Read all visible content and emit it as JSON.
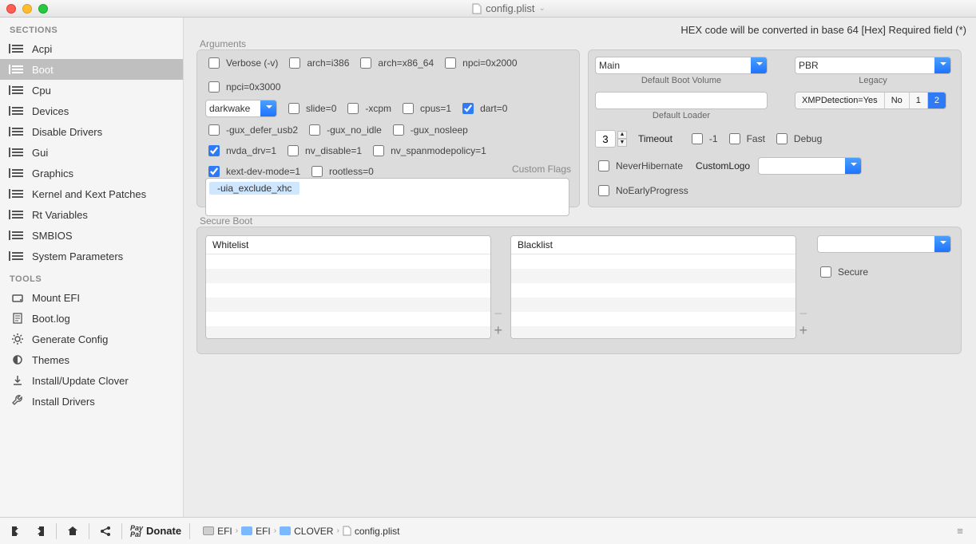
{
  "window": {
    "title": "config.plist"
  },
  "top_note": "HEX code will be converted in base 64 [Hex]    Required field (*)",
  "sidebar": {
    "header_sections": "SECTIONS",
    "header_tools": "TOOLS",
    "sections": [
      {
        "label": "Acpi",
        "selected": false
      },
      {
        "label": "Boot",
        "selected": true
      },
      {
        "label": "Cpu",
        "selected": false
      },
      {
        "label": "Devices",
        "selected": false
      },
      {
        "label": "Disable Drivers",
        "selected": false
      },
      {
        "label": "Gui",
        "selected": false
      },
      {
        "label": "Graphics",
        "selected": false
      },
      {
        "label": "Kernel and Kext Patches",
        "selected": false
      },
      {
        "label": "Rt Variables",
        "selected": false
      },
      {
        "label": "SMBIOS",
        "selected": false
      },
      {
        "label": "System Parameters",
        "selected": false
      }
    ],
    "tools": [
      {
        "label": "Mount EFI",
        "icon": "drive"
      },
      {
        "label": "Boot.log",
        "icon": "log"
      },
      {
        "label": "Generate Config",
        "icon": "gear"
      },
      {
        "label": "Themes",
        "icon": "theme"
      },
      {
        "label": "Install/Update Clover",
        "icon": "download"
      },
      {
        "label": "Install Drivers",
        "icon": "wrench"
      }
    ]
  },
  "arguments": {
    "title": "Arguments",
    "row1": [
      {
        "label": "Verbose (-v)",
        "checked": false
      },
      {
        "label": "arch=i386",
        "checked": false
      },
      {
        "label": "arch=x86_64",
        "checked": false
      },
      {
        "label": "npci=0x2000",
        "checked": false
      },
      {
        "label": "npci=0x3000",
        "checked": false
      }
    ],
    "darkwake": "darkwake",
    "row2": [
      {
        "label": "slide=0",
        "checked": false
      },
      {
        "label": "-xcpm",
        "checked": false
      },
      {
        "label": "cpus=1",
        "checked": false
      },
      {
        "label": "dart=0",
        "checked": true
      }
    ],
    "row3": [
      {
        "label": "-gux_defer_usb2",
        "checked": false
      },
      {
        "label": "-gux_no_idle",
        "checked": false
      },
      {
        "label": "-gux_nosleep",
        "checked": false
      }
    ],
    "row4": [
      {
        "label": "nvda_drv=1",
        "checked": true
      },
      {
        "label": "nv_disable=1",
        "checked": false
      },
      {
        "label": "nv_spanmodepolicy=1",
        "checked": false
      }
    ],
    "row5": [
      {
        "label": "kext-dev-mode=1",
        "checked": true
      },
      {
        "label": "rootless=0",
        "checked": false
      }
    ],
    "custom_flags_label": "Custom Flags",
    "custom_flag": "-uia_exclude_xhc"
  },
  "right": {
    "default_boot_volume": {
      "label": "Default Boot Volume",
      "value": "Main"
    },
    "legacy": {
      "label": "Legacy",
      "value": "PBR"
    },
    "default_loader": {
      "label": "Default Loader",
      "value": ""
    },
    "xmp": {
      "segments": [
        "XMPDetection=Yes",
        "No",
        "1",
        "2"
      ],
      "active": 3
    },
    "timeout": {
      "label": "Timeout",
      "value": "3"
    },
    "minus1": {
      "label": "-1",
      "checked": false
    },
    "fast": {
      "label": "Fast",
      "checked": false
    },
    "debug": {
      "label": "Debug",
      "checked": false
    },
    "never_hibernate": {
      "label": "NeverHibernate",
      "checked": false
    },
    "custom_logo": {
      "label": "CustomLogo",
      "value": ""
    },
    "no_early_progress": {
      "label": "NoEarlyProgress",
      "checked": false
    }
  },
  "secure_boot": {
    "title": "Secure Boot",
    "whitelist": "Whitelist",
    "blacklist": "Blacklist",
    "secure": "Secure"
  },
  "footer": {
    "donate": "Donate",
    "breadcrumb": [
      "EFI",
      "EFI",
      "CLOVER",
      "config.plist"
    ]
  }
}
